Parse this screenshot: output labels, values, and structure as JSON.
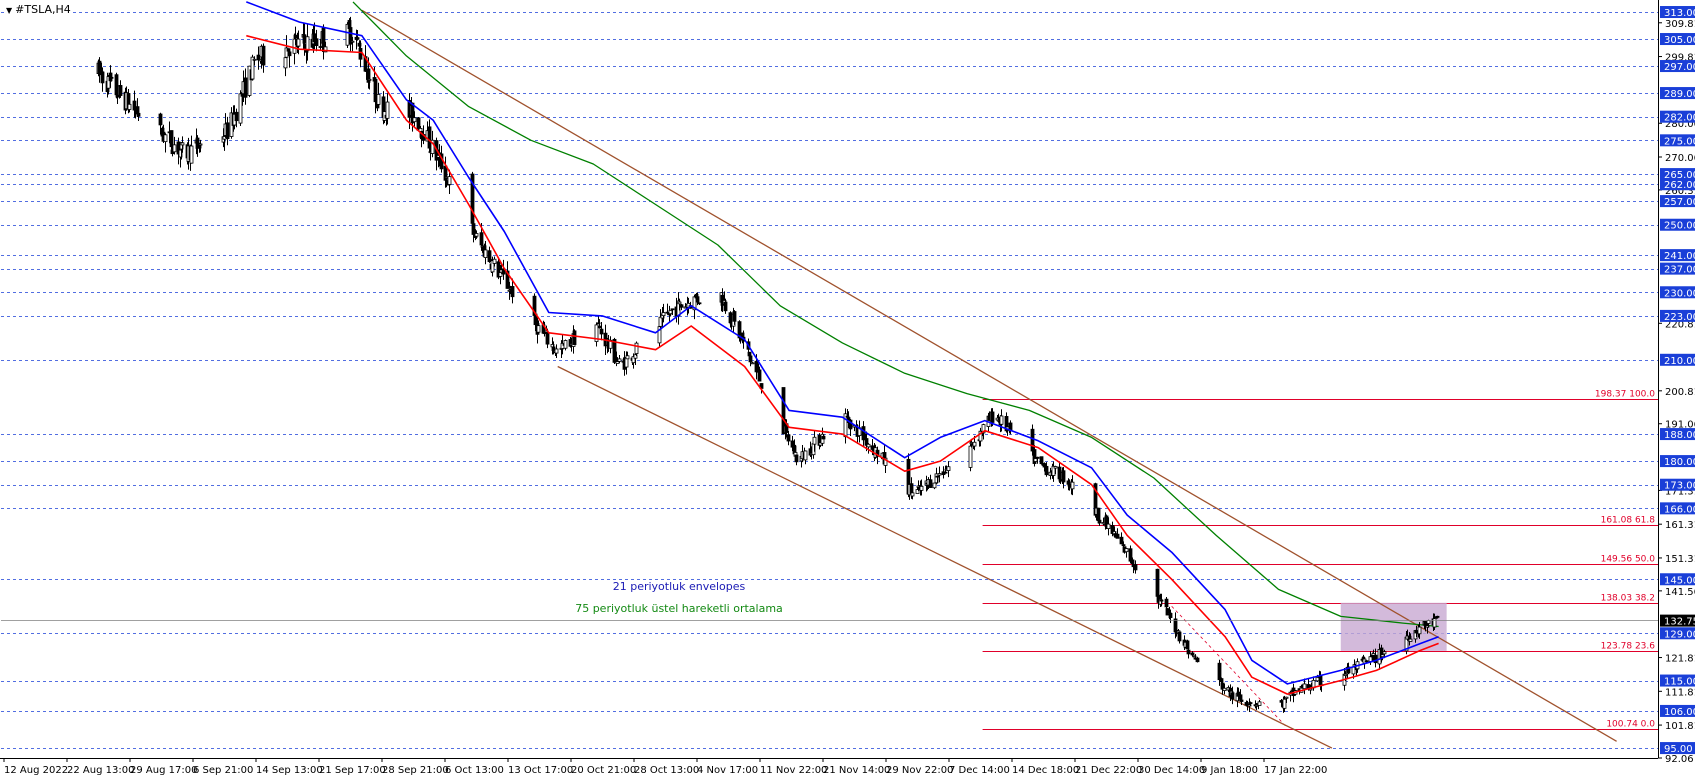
{
  "window": {
    "title": "#TSLA,H4",
    "menu_icon": "triangle-down-icon"
  },
  "chart_data": {
    "type": "line",
    "symbol": "#TSLA",
    "timeframe": "H4",
    "title": "#TSLA,H4",
    "ylim": [
      92.06,
      316.56
    ],
    "grid": false,
    "x_ticks": [
      "12 Aug 2022",
      "22 Aug 13:00",
      "29 Aug 17:00",
      "6 Sep 21:00",
      "14 Sep 13:00",
      "21 Sep 17:00",
      "28 Sep 21:00",
      "6 Oct 13:00",
      "13 Oct 17:00",
      "20 Oct 21:00",
      "28 Oct 13:00",
      "4 Nov 17:00",
      "11 Nov 22:00",
      "21 Nov 14:00",
      "29 Nov 22:00",
      "7 Dec 14:00",
      "14 Dec 18:00",
      "21 Dec 22:00",
      "30 Dec 14:00",
      "9 Jan 18:00",
      "17 Jan 22:00"
    ],
    "y_ticks": [
      "309.81",
      "299.81",
      "280.06",
      "270.06",
      "260.31",
      "220.81",
      "200.81",
      "191.06",
      "171.31",
      "161.31",
      "151.31",
      "141.56",
      "121.81",
      "111.81",
      "101.81",
      "92.06"
    ],
    "horizontal_levels": [
      "313.00",
      "305.00",
      "297.00",
      "289.00",
      "282.00",
      "275.00",
      "265.00",
      "262.00",
      "257.00",
      "250.00",
      "241.00",
      "237.00",
      "230.00",
      "223.00",
      "210.00",
      "188.00",
      "180.00",
      "173.00",
      "166.00",
      "145.00",
      "129.00",
      "115.00",
      "106.00",
      "95.00"
    ],
    "level_color": "#1a3fd8",
    "current_price": "132.75",
    "fibonacci": {
      "color": "#e0002a",
      "levels": [
        {
          "price": 198.37,
          "label": "198.37 100.0"
        },
        {
          "price": 161.08,
          "label": "161.08 61.8"
        },
        {
          "price": 149.56,
          "label": "149.56 50.0"
        },
        {
          "price": 138.03,
          "label": "138.03 38.2"
        },
        {
          "price": 123.78,
          "label": "123.78 23.6"
        },
        {
          "price": 100.74,
          "label": "100.74 0.0"
        }
      ]
    },
    "annotations": [
      {
        "text": "21 periyotluk envelopes",
        "color": "#1a1ab4"
      },
      {
        "text": "75 periyotluk üstel hareketli ortalama",
        "color": "#138a13"
      }
    ],
    "colors": {
      "candles": "#000000",
      "envelope_upper": "#0000ff",
      "envelope_lower": "#ff0000",
      "ema75": "#008000",
      "channel": "#a0522d",
      "highlight_box": "#c8a9d2",
      "axis": "#000000",
      "fib_dashed": "#e0002a"
    },
    "series": [
      {
        "name": "21 periyotluk envelopes (upper)",
        "kind": "envelope_upper",
        "x": [
          "2022-09-08",
          "2022-09-14",
          "2022-09-21",
          "2022-09-26",
          "2022-09-29",
          "2022-10-03",
          "2022-10-07",
          "2022-10-12",
          "2022-10-18",
          "2022-10-24",
          "2022-10-28",
          "2022-11-03",
          "2022-11-08",
          "2022-11-14",
          "2022-11-21",
          "2022-11-25",
          "2022-11-30",
          "2022-12-06",
          "2022-12-12",
          "2022-12-16",
          "2022-12-21",
          "2022-12-27",
          "2022-12-30",
          "2023-01-03",
          "2023-01-09",
          "2023-01-13",
          "2023-01-18",
          "2023-01-20"
        ],
        "y": [
          316,
          310,
          306,
          287,
          281,
          264,
          248,
          224,
          223,
          218,
          226,
          216,
          195,
          193,
          181,
          187,
          192,
          186,
          178,
          164,
          153,
          136,
          121,
          114,
          118,
          121,
          126,
          128
        ]
      },
      {
        "name": "21 periyotluk envelopes (lower)",
        "kind": "envelope_lower",
        "x": [
          "2022-09-08",
          "2022-09-14",
          "2022-09-21",
          "2022-09-26",
          "2022-09-29",
          "2022-10-03",
          "2022-10-07",
          "2022-10-12",
          "2022-10-18",
          "2022-10-24",
          "2022-10-28",
          "2022-11-03",
          "2022-11-08",
          "2022-11-14",
          "2022-11-21",
          "2022-11-25",
          "2022-11-30",
          "2022-12-06",
          "2022-12-12",
          "2022-12-16",
          "2022-12-21",
          "2022-12-27",
          "2022-12-30",
          "2023-01-03",
          "2023-01-09",
          "2023-01-13",
          "2023-01-18",
          "2023-01-20"
        ],
        "y": [
          306,
          302,
          301,
          281,
          274,
          256,
          237,
          218,
          216,
          213,
          220,
          208,
          190,
          188,
          177,
          180,
          189,
          184,
          173,
          158,
          145,
          128,
          116,
          111,
          115,
          118,
          124,
          126
        ]
      },
      {
        "name": "75 periyotluk üstel hareketli ortalama",
        "kind": "ema75",
        "x": [
          "2022-09-20",
          "2022-09-26",
          "2022-10-03",
          "2022-10-10",
          "2022-10-17",
          "2022-10-24",
          "2022-10-31",
          "2022-11-07",
          "2022-11-14",
          "2022-11-21",
          "2022-11-28",
          "2022-12-05",
          "2022-12-12",
          "2022-12-19",
          "2022-12-26",
          "2023-01-02",
          "2023-01-09",
          "2023-01-16",
          "2023-01-20"
        ],
        "y": [
          316,
          300,
          285,
          275,
          268,
          256,
          244,
          226,
          215,
          206,
          200,
          195,
          187,
          175,
          158,
          142,
          134,
          132,
          131
        ]
      },
      {
        "name": "channel (upper)",
        "kind": "channel",
        "x": [
          "2022-09-21",
          "2023-02-09"
        ],
        "y": [
          313.5,
          97
        ]
      },
      {
        "name": "channel (lower)",
        "kind": "channel",
        "x": [
          "2022-10-13",
          "2023-01-08"
        ],
        "y": [
          208,
          95
        ]
      }
    ],
    "candles": {
      "interval_hours": 4,
      "anchor": {
        "date": "2022-08-22 13:00",
        "open": 291,
        "high": 304,
        "low": 286,
        "close": 295
      },
      "waypoints": [
        {
          "date": "2022-08-22",
          "price": 296
        },
        {
          "date": "2022-08-26",
          "price": 285
        },
        {
          "date": "2022-09-01",
          "price": 271
        },
        {
          "date": "2022-09-06",
          "price": 278
        },
        {
          "date": "2022-09-09",
          "price": 299
        },
        {
          "date": "2022-09-13",
          "price": 303
        },
        {
          "date": "2022-09-20",
          "price": 307
        },
        {
          "date": "2022-09-23",
          "price": 285
        },
        {
          "date": "2022-09-27",
          "price": 282
        },
        {
          "date": "2022-09-30",
          "price": 267
        },
        {
          "date": "2022-10-04",
          "price": 245
        },
        {
          "date": "2022-10-10",
          "price": 222
        },
        {
          "date": "2022-10-13",
          "price": 212
        },
        {
          "date": "2022-10-17",
          "price": 222
        },
        {
          "date": "2022-10-20",
          "price": 208
        },
        {
          "date": "2022-10-26",
          "price": 225
        },
        {
          "date": "2022-10-31",
          "price": 231
        },
        {
          "date": "2022-11-04",
          "price": 208
        },
        {
          "date": "2022-11-09",
          "price": 180
        },
        {
          "date": "2022-11-14",
          "price": 194
        },
        {
          "date": "2022-11-22",
          "price": 170
        },
        {
          "date": "2022-11-28",
          "price": 183
        },
        {
          "date": "2022-12-01",
          "price": 194
        },
        {
          "date": "2022-12-06",
          "price": 179
        },
        {
          "date": "2022-12-09",
          "price": 175
        },
        {
          "date": "2022-12-14",
          "price": 160
        },
        {
          "date": "2022-12-20",
          "price": 137
        },
        {
          "date": "2022-12-23",
          "price": 123
        },
        {
          "date": "2022-12-28",
          "price": 110
        },
        {
          "date": "2023-01-02",
          "price": 107
        },
        {
          "date": "2023-01-04",
          "price": 112
        },
        {
          "date": "2023-01-10",
          "price": 118
        },
        {
          "date": "2023-01-13",
          "price": 122
        },
        {
          "date": "2023-01-18",
          "price": 131
        },
        {
          "date": "2023-01-20",
          "price": 132.75
        }
      ]
    },
    "highlight_box": {
      "x": [
        "2023-01-09",
        "2023-01-20"
      ],
      "y": [
        123.78,
        138.03
      ]
    },
    "fib_dashed": {
      "x": [
        "2022-12-21",
        "2023-01-03"
      ],
      "y": [
        137,
        101
      ]
    }
  }
}
